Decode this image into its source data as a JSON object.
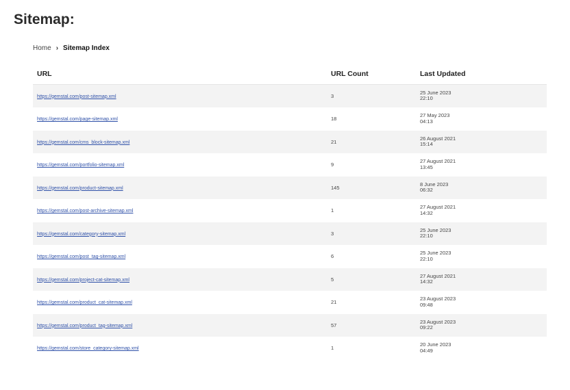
{
  "page": {
    "title": "Sitemap:"
  },
  "breadcrumb": {
    "home": "Home",
    "separator": "›",
    "current": "Sitemap Index"
  },
  "table": {
    "headers": {
      "url": "URL",
      "count": "URL Count",
      "updated": "Last Updated"
    },
    "rows": [
      {
        "url": "https://gemstal.com/post-sitemap.xml",
        "count": "3",
        "date": "25 June 2023",
        "time": "22:10"
      },
      {
        "url": "https://gemstal.com/page-sitemap.xml",
        "count": "18",
        "date": "27 May 2023",
        "time": "04:13"
      },
      {
        "url": "https://gemstal.com/cms_block-sitemap.xml",
        "count": "21",
        "date": "26 August 2021",
        "time": "15:14"
      },
      {
        "url": "https://gemstal.com/portfolio-sitemap.xml",
        "count": "9",
        "date": "27 August 2021",
        "time": "13:45"
      },
      {
        "url": "https://gemstal.com/product-sitemap.xml",
        "count": "145",
        "date": "8 June 2023",
        "time": "06:32"
      },
      {
        "url": "https://gemstal.com/post-archive-sitemap.xml",
        "count": "1",
        "date": "27 August 2021",
        "time": "14:32"
      },
      {
        "url": "https://gemstal.com/category-sitemap.xml",
        "count": "3",
        "date": "25 June 2023",
        "time": "22:10"
      },
      {
        "url": "https://gemstal.com/post_tag-sitemap.xml",
        "count": "6",
        "date": "25 June 2023",
        "time": "22:10"
      },
      {
        "url": "https://gemstal.com/project-cat-sitemap.xml",
        "count": "5",
        "date": "27 August 2021",
        "time": "14:32"
      },
      {
        "url": "https://gemstal.com/product_cat-sitemap.xml",
        "count": "21",
        "date": "23 August 2023",
        "time": "09:48"
      },
      {
        "url": "https://gemstal.com/product_tag-sitemap.xml",
        "count": "57",
        "date": "23 August 2023",
        "time": "09:22"
      },
      {
        "url": "https://gemstal.com/store_category-sitemap.xml",
        "count": "1",
        "date": "20 June 2023",
        "time": "04:49"
      }
    ]
  }
}
